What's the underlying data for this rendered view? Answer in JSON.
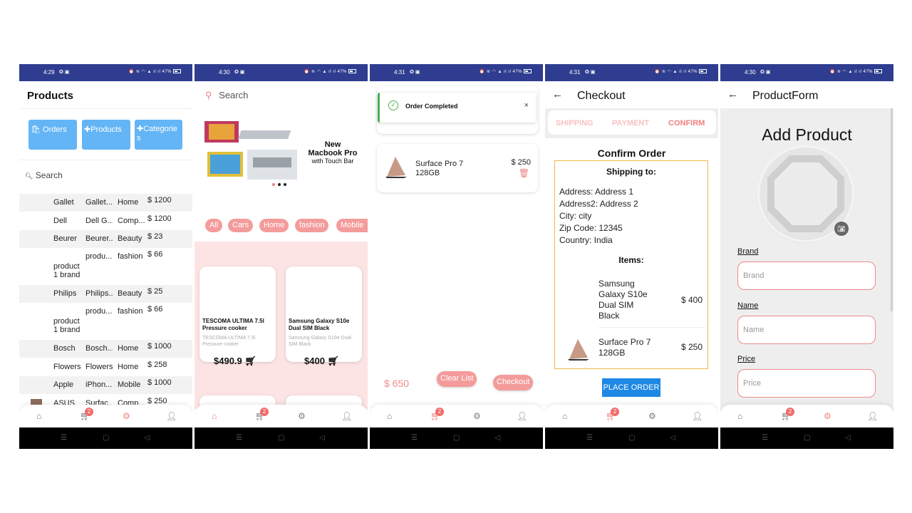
{
  "status": {
    "s1_time": "4:29",
    "s2_time": "4:30",
    "s3_time": "4:31",
    "s4_time": "4:31",
    "s5_time": "4:30",
    "battery": "47%"
  },
  "tabbar": {
    "cart_badge": "2"
  },
  "screen1": {
    "title": "Products",
    "btn_orders": "Orders",
    "btn_products": "Products",
    "btn_categories": "Categories",
    "search_placeholder": "Search",
    "rows": [
      {
        "name": "Gallet",
        "desc": "Gallet...",
        "cat": "Home",
        "price": "$ 1200"
      },
      {
        "name": "Dell",
        "desc": "Dell G...",
        "cat": "Comp...",
        "price": "$ 1200"
      },
      {
        "name": "Beurer",
        "desc": "Beurer...",
        "cat": "Beauty",
        "price": "$ 23"
      },
      {
        "name": "product 1 brand",
        "desc": "produ...",
        "cat": "fashion",
        "price": "$ 66"
      },
      {
        "name": "Philips",
        "desc": "Philips...",
        "cat": "Beauty",
        "price": "$ 25"
      },
      {
        "name": "product 1 brand",
        "desc": "produ...",
        "cat": "fashion",
        "price": "$ 66"
      },
      {
        "name": "Bosch",
        "desc": "Bosch...",
        "cat": "Home",
        "price": "$ 1000"
      },
      {
        "name": "Flowers",
        "desc": "Flowers",
        "cat": "Home",
        "price": "$ 258"
      },
      {
        "name": "Apple",
        "desc": "iPhon...",
        "cat": "Mobile",
        "price": "$ 1000"
      },
      {
        "name": "ASUS",
        "desc": "Surfac...",
        "cat": "Comp...",
        "price": "$ 250"
      }
    ]
  },
  "screen2": {
    "search_placeholder": "Search",
    "banner_line1": "New",
    "banner_line2": "Macbook Pro",
    "banner_line3": "with Touch Bar",
    "chips": [
      "All",
      "Cars",
      "Home",
      "fashion",
      "Mobile"
    ],
    "cards": [
      {
        "name": "TESCOMA ULTIMA 7.5l Pressure cooker",
        "desc": "TESCOMA ULTIMA 7.5l Pressure cooker",
        "price": "$490.9"
      },
      {
        "name": "Samsung Galaxy S10e Dual SIM Black",
        "desc": "Samsung Galaxy S10e Dual SIM Black",
        "price": "$400"
      }
    ]
  },
  "screen3": {
    "toast": "Order Completed",
    "item_name": "Surface Pro 7 128GB",
    "item_price": "$ 250",
    "total": "$ 650",
    "clear_label": "Clear List",
    "checkout_label": "Checkout"
  },
  "screen4": {
    "title": "Checkout",
    "step_shipping": "SHIPPING",
    "step_payment": "PAYMENT",
    "step_confirm": "CONFIRM",
    "confirm_heading": "Confirm Order",
    "shipping_heading": "Shipping to:",
    "address": "Address: Address 1",
    "address2": "Address2: Address 2",
    "city": "City: city",
    "zip": "Zip Code: 12345",
    "country": "Country: India",
    "items_heading": "Items:",
    "item1_name": "Samsung Galaxy S10e Dual SIM Black",
    "item1_price": "$ 400",
    "item2_name": "Surface Pro 7 128GB",
    "item2_price": "$ 250",
    "place_order": "PLACE ORDER"
  },
  "screen5": {
    "title": "ProductForm",
    "heading": "Add Product",
    "brand_label": "Brand",
    "brand_placeholder": "Brand",
    "name_label": "Name",
    "name_placeholder": "Name",
    "price_label": "Price",
    "price_placeholder": "Price"
  },
  "colors": {
    "status_bar": "#2e3d8f",
    "accent_pink": "#f08080",
    "blue_button": "#64b5f6",
    "place_order": "#1e88e5"
  }
}
